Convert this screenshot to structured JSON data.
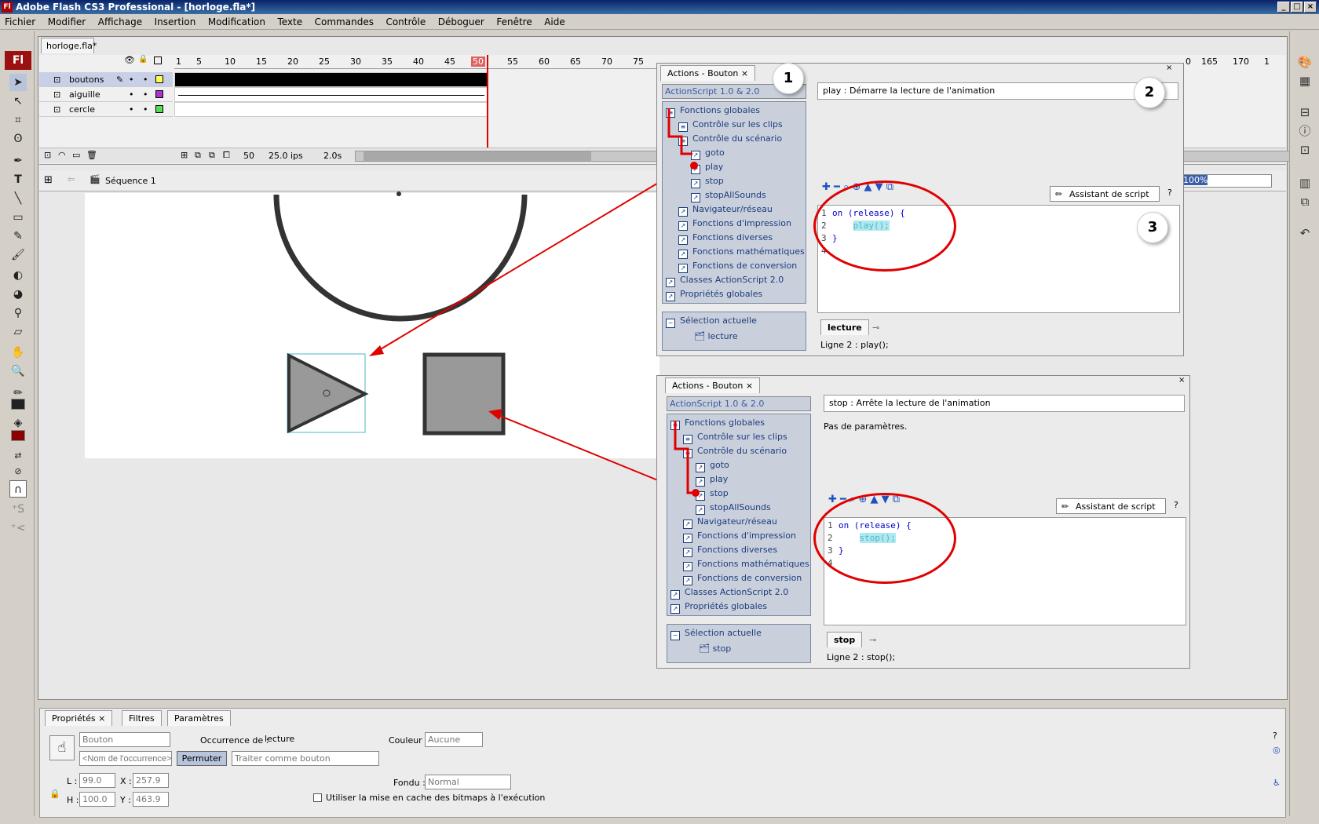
{
  "window": {
    "title": "Adobe Flash CS3 Professional - [horloge.fla*]"
  },
  "menu": [
    "Fichier",
    "Modifier",
    "Affichage",
    "Insertion",
    "Modification",
    "Texte",
    "Commandes",
    "Contrôle",
    "Déboguer",
    "Fenêtre",
    "Aide"
  ],
  "document": {
    "tab": "horloge.fla*",
    "scene": "Séquence 1",
    "zoom": "100%"
  },
  "timeline": {
    "layers": [
      "boutons",
      "aiguille",
      "cercle"
    ],
    "layer_colors": [
      "#ffff55",
      "#aa33cc",
      "#55dd55"
    ],
    "ruler": [
      "1",
      "5",
      "10",
      "15",
      "20",
      "25",
      "30",
      "35",
      "40",
      "45",
      "50",
      "55",
      "60",
      "65",
      "70",
      "75"
    ],
    "ruler_right": [
      "0",
      "165",
      "170",
      "1"
    ],
    "frame": "50",
    "fps": "25.0 ips",
    "time": "2.0s"
  },
  "panel_top": {
    "tab": "Actions - Bouton",
    "version": "ActionScript 1.0 & 2.0",
    "tree": [
      "Fonctions globales",
      "Contrôle sur les clips",
      "Contrôle du scénario",
      "goto",
      "play",
      "stop",
      "stopAllSounds",
      "Navigateur/réseau",
      "Fonctions d'impression",
      "Fonctions diverses",
      "Fonctions mathématiques",
      "Fonctions de conversion",
      "Classes ActionScript 2.0",
      "Propriétés globales"
    ],
    "selection": {
      "header": "Sélection actuelle",
      "item": "lecture"
    },
    "description": "play : Démarre la lecture de l'animation",
    "param": "",
    "assist": "Assistant de script",
    "code": {
      "l1": "on (release) {",
      "l2": "play();",
      "l3": "}"
    },
    "linenums": [
      "1",
      "2",
      "3",
      "4"
    ],
    "script_tab": "lecture",
    "status": "Ligne 2 : play();"
  },
  "panel_bottom": {
    "tab": "Actions - Bouton",
    "version": "ActionScript 1.0 & 2.0",
    "tree": [
      "Fonctions globales",
      "Contrôle sur les clips",
      "Contrôle du scénario",
      "goto",
      "play",
      "stop",
      "stopAllSounds",
      "Navigateur/réseau",
      "Fonctions d'impression",
      "Fonctions diverses",
      "Fonctions mathématiques",
      "Fonctions de conversion",
      "Classes ActionScript 2.0",
      "Propriétés globales"
    ],
    "selection": {
      "header": "Sélection actuelle",
      "item": "stop"
    },
    "description": "stop : Arrête la lecture de l'animation",
    "param": "Pas de paramètres.",
    "assist": "Assistant de script",
    "code": {
      "l1": "on (release) {",
      "l2": "stop();",
      "l3": "}"
    },
    "linenums": [
      "1",
      "2",
      "3",
      "4"
    ],
    "script_tab": "stop",
    "status": "Ligne 2 : stop();"
  },
  "callouts": [
    "1",
    "2",
    "3"
  ],
  "properties": {
    "tabs": [
      "Propriétés",
      "Filtres",
      "Paramètres"
    ],
    "type": "Bouton",
    "instance_label": "Occurrence de :",
    "instance_of": "lecture",
    "instance_name_placeholder": "<Nom de l'occurrence>",
    "swap": "Permuter",
    "track": "Traiter comme bouton",
    "color_label": "Couleur :",
    "color": "Aucune",
    "blend_label": "Fondu :",
    "blend": "Normal",
    "w_label": "L :",
    "w": "99.0",
    "h_label": "H :",
    "h": "100.0",
    "x_label": "X :",
    "x": "257.9",
    "y_label": "Y :",
    "y": "463.9",
    "cache": "Utiliser la mise en cache des bitmaps à l'exécution"
  }
}
